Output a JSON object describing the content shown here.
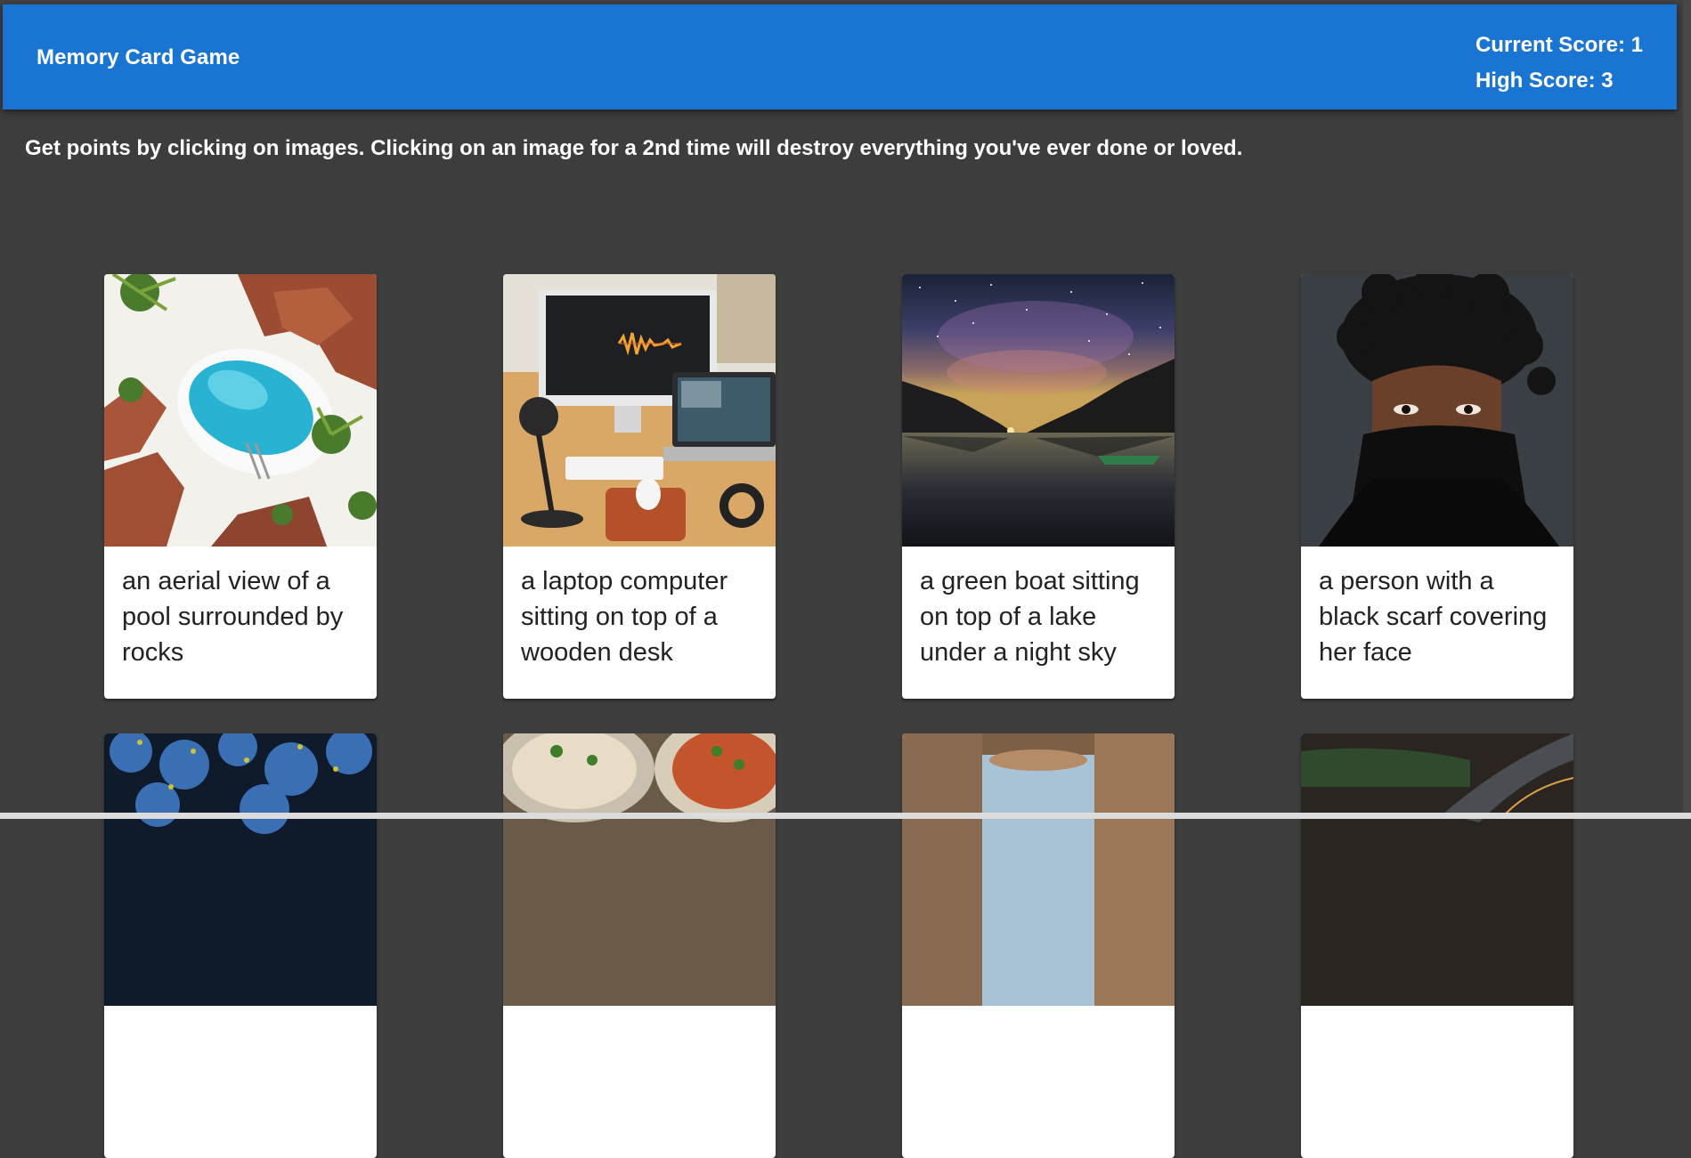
{
  "app": {
    "title": "Memory Card Game",
    "current_score_label": "Current Score: 1",
    "high_score_label": "High Score: 3"
  },
  "instructions": "Get points by clicking on images. Clicking on an image for a 2nd time will destroy everything you've ever done or loved.",
  "colors": {
    "appbar": "#1a75d2",
    "background": "#3d3d3d",
    "card": "#ffffff"
  },
  "cards": [
    {
      "caption": "an aerial view of a pool surrounded by rocks",
      "image": "pool-aerial-image"
    },
    {
      "caption": "a laptop computer sitting on top of a wooden desk",
      "image": "desk-laptop-image"
    },
    {
      "caption": "a green boat sitting on top of a lake under a night sky",
      "image": "night-lake-image"
    },
    {
      "caption": "a person with a black scarf covering her face",
      "image": "person-scarf-image"
    },
    {
      "caption": "",
      "image": "blue-cells-image"
    },
    {
      "caption": "",
      "image": "food-bowls-image"
    },
    {
      "caption": "",
      "image": "stone-columns-image"
    },
    {
      "caption": "",
      "image": "dark-landscape-image"
    }
  ]
}
